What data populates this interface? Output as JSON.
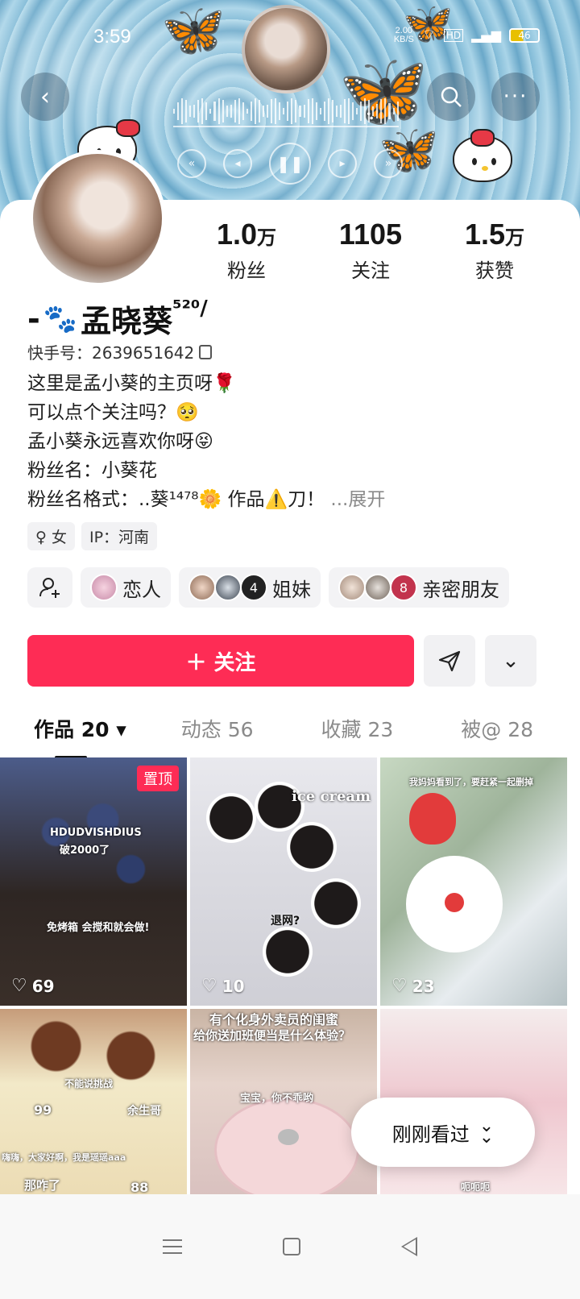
{
  "status_bar": {
    "time": "3:59",
    "net_speed_value": "2.00",
    "net_speed_unit": "KB/S",
    "hd_label": "HD",
    "battery_level": "46"
  },
  "header": {
    "back_icon": "chevron-left-icon",
    "search_icon": "search-icon",
    "more_icon": "more-dots-icon"
  },
  "profile": {
    "name_prefix": "-",
    "name": "孟晓葵",
    "name_suffix": "⁵²⁰/",
    "id_label": "快手号：2639651642",
    "bio_lines": [
      "这里是孟小葵的主页呀🌹",
      "可以点个关注吗？🥺",
      "孟小葵永远喜欢你呀😝",
      "粉丝名：小葵花",
      "粉丝名格式：..葵¹⁴⁷⁸🌼 作品⚠️刀！"
    ],
    "bio_more": "...展开",
    "tags": [
      "♀ 女",
      "IP：河南"
    ]
  },
  "stats": [
    {
      "num": "1.0",
      "unit": "万",
      "label": "粉丝"
    },
    {
      "num": "1105",
      "unit": "",
      "label": "关注"
    },
    {
      "num": "1.5",
      "unit": "万",
      "label": "获赞"
    }
  ],
  "relations": [
    {
      "label": "恋人",
      "count": ""
    },
    {
      "label": "姐妹",
      "count": "4"
    },
    {
      "label": "亲密朋友",
      "count": "8"
    }
  ],
  "actions": {
    "follow_label": "＋ 关注"
  },
  "tabs": [
    {
      "label": "作品 20 ▾"
    },
    {
      "label": "动态 56"
    },
    {
      "label": "收藏 23"
    },
    {
      "label": "被@ 28"
    }
  ],
  "posts": [
    {
      "likes": "69",
      "pinned_label": "置顶",
      "overlay_1": "HDUDVISHDIUS",
      "overlay_2": "破2000了",
      "overlay_3": "免烤箱 会搅和就会做!"
    },
    {
      "likes": "10",
      "overlay_1": "ice cream",
      "overlay_2": "退网?"
    },
    {
      "likes": "23",
      "overlay_1": "我妈妈看到了，要赶紧一起删掉"
    },
    {
      "overlay_1": "不能说挑战",
      "overlay_2": "99",
      "overlay_3": "余生哥",
      "overlay_4": "嗨嗨，大家好啊，我是瑶瑶aaa",
      "overlay_5": "那咋了",
      "overlay_6": "88"
    },
    {
      "overlay_1": "有个化身外卖员的闺蜜",
      "overlay_2": "给你送加班便当是什么体验？",
      "overlay_3": "宝宝，你不乖哟"
    },
    {
      "overlay_1": "呃呃呃"
    }
  ],
  "recent": {
    "label": "刚刚看过"
  },
  "colors": {
    "accent": "#fe2c55",
    "banner": "#8fc3dc"
  }
}
